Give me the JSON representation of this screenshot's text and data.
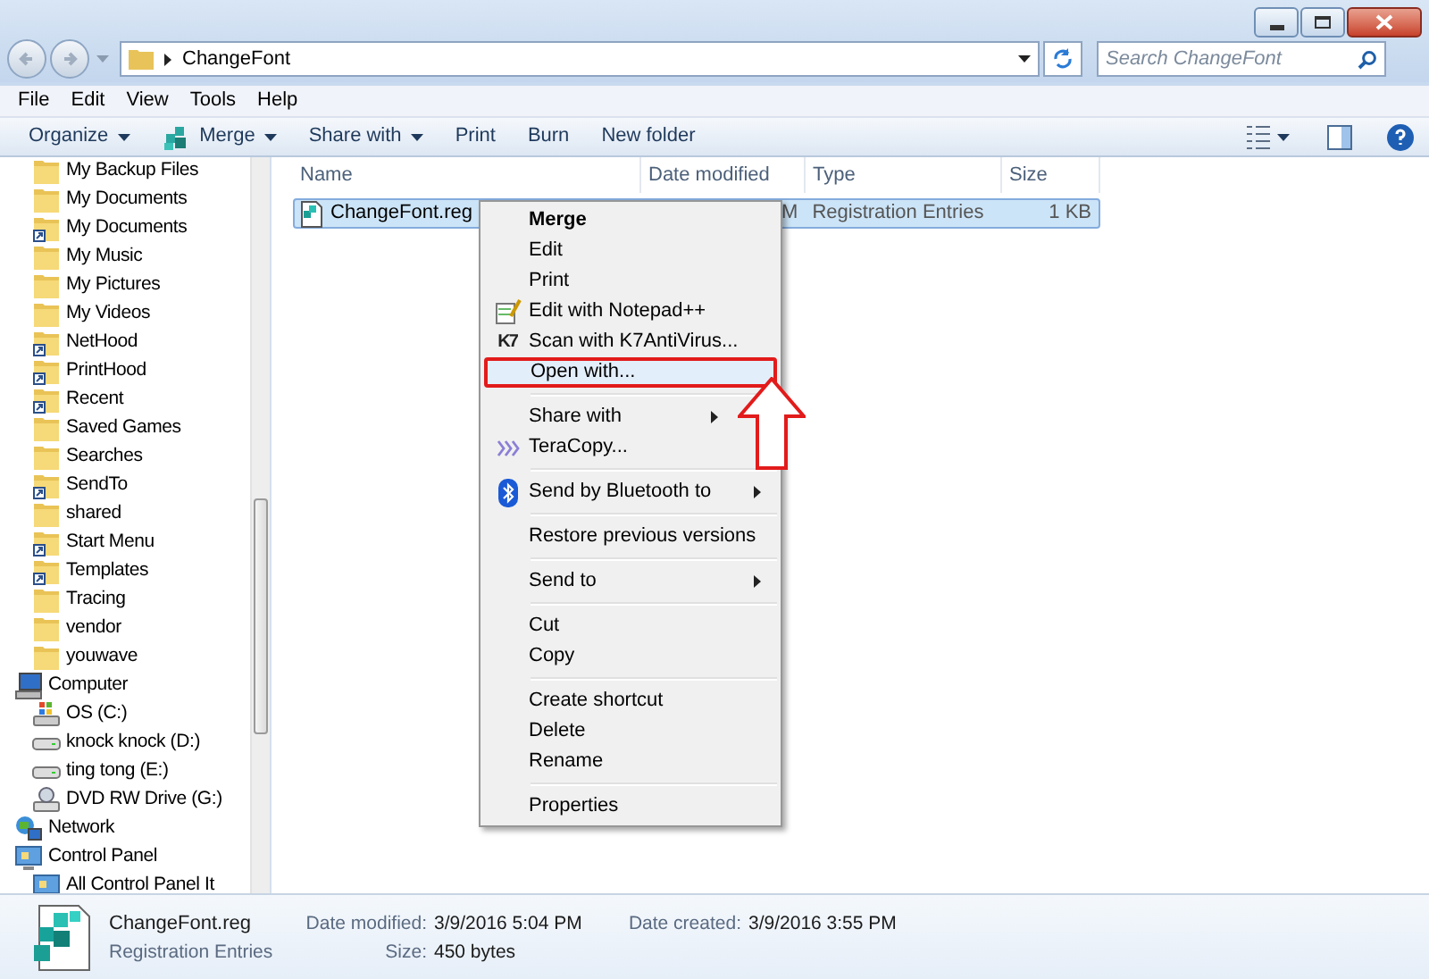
{
  "address": {
    "path": "ChangeFont",
    "search_placeholder": "Search ChangeFont"
  },
  "menu_bar": [
    "File",
    "Edit",
    "View",
    "Tools",
    "Help"
  ],
  "toolbar": [
    {
      "label": "Organize",
      "dropdown": true
    },
    {
      "label": "Merge",
      "dropdown": true
    },
    {
      "label": "Share with",
      "dropdown": true
    },
    {
      "label": "Print",
      "dropdown": false
    },
    {
      "label": "Burn",
      "dropdown": false
    },
    {
      "label": "New folder",
      "dropdown": false
    }
  ],
  "sidebar": {
    "items": [
      {
        "children": [
          {
            "label": "My Backup Files",
            "kind": "folder"
          },
          {
            "label": "My Documents",
            "kind": "folder"
          },
          {
            "label": "My Documents",
            "kind": "shortcut"
          },
          {
            "label": "My Music",
            "kind": "folder"
          },
          {
            "label": "My Pictures",
            "kind": "folder"
          },
          {
            "label": "My Videos",
            "kind": "folder"
          },
          {
            "label": "NetHood",
            "kind": "shortcut"
          },
          {
            "label": "PrintHood",
            "kind": "shortcut"
          },
          {
            "label": "Recent",
            "kind": "shortcut"
          },
          {
            "label": "Saved Games",
            "kind": "folder"
          },
          {
            "label": "Searches",
            "kind": "folder"
          },
          {
            "label": "SendTo",
            "kind": "shortcut"
          },
          {
            "label": "shared",
            "kind": "folder"
          },
          {
            "label": "Start Menu",
            "kind": "shortcut"
          },
          {
            "label": "Templates",
            "kind": "shortcut"
          },
          {
            "label": "Tracing",
            "kind": "folder"
          },
          {
            "label": "vendor",
            "kind": "folder"
          },
          {
            "label": "youwave",
            "kind": "folder"
          }
        ]
      },
      {
        "label": "Computer",
        "kind": "computer",
        "children": [
          {
            "label": "OS (C:)",
            "kind": "system"
          },
          {
            "label": "knock knock (D:)",
            "kind": "drive"
          },
          {
            "label": "ting tong (E:)",
            "kind": "drive"
          },
          {
            "label": "DVD RW Drive (G:)",
            "kind": "dvd"
          }
        ]
      },
      {
        "label": "Network",
        "kind": "network"
      },
      {
        "label": "Control Panel",
        "kind": "panel",
        "children": [
          {
            "label": "All Control Panel It",
            "kind": "panel"
          }
        ]
      }
    ]
  },
  "table": {
    "columns": [
      "Name",
      "Date modified",
      "Type",
      "Size"
    ],
    "rows": [
      {
        "name": "ChangeFont.reg",
        "date_modified": "M",
        "type": "Registration Entries",
        "size": "1 KB",
        "selected": true
      }
    ]
  },
  "context_menu": {
    "items": [
      {
        "kind": "plain",
        "label": "Merge",
        "default": true,
        "submenu": false,
        "selected": false,
        "highlighted": false
      },
      {
        "kind": "plain",
        "label": "Edit",
        "default": false,
        "submenu": false,
        "selected": false,
        "highlighted": false
      },
      {
        "kind": "plain",
        "label": "Print",
        "default": false,
        "submenu": false,
        "selected": false,
        "highlighted": false
      },
      {
        "kind": "notepad",
        "label": "Edit with Notepad++",
        "default": false,
        "submenu": false,
        "selected": false,
        "highlighted": false
      },
      {
        "kind": "antivirus",
        "label": "Scan with K7AntiVirus...",
        "badge": "K7",
        "default": false,
        "submenu": false,
        "selected": false,
        "highlighted": false
      },
      {
        "kind": "plain",
        "label": "Open with...",
        "default": false,
        "submenu": false,
        "selected": true,
        "highlighted": true
      },
      {
        "kind": "separator"
      },
      {
        "kind": "plain",
        "label": "Share with",
        "default": false,
        "submenu": true,
        "selected": false,
        "highlighted": false
      },
      {
        "kind": "teracopy",
        "label": "TeraCopy...",
        "default": false,
        "submenu": false,
        "selected": false,
        "highlighted": false
      },
      {
        "kind": "separator"
      },
      {
        "kind": "bluetooth",
        "label": "Send by Bluetooth to",
        "default": false,
        "submenu": true,
        "selected": false,
        "highlighted": false
      },
      {
        "kind": "separator"
      },
      {
        "kind": "plain",
        "label": "Restore previous versions",
        "default": false,
        "submenu": false,
        "selected": false,
        "highlighted": false
      },
      {
        "kind": "separator"
      },
      {
        "kind": "plain",
        "label": "Send to",
        "default": false,
        "submenu": true,
        "selected": false,
        "highlighted": false
      },
      {
        "kind": "separator"
      },
      {
        "kind": "plain",
        "label": "Cut",
        "default": false,
        "submenu": false,
        "selected": false,
        "highlighted": false
      },
      {
        "kind": "plain",
        "label": "Copy",
        "default": false,
        "submenu": false,
        "selected": false,
        "highlighted": false
      },
      {
        "kind": "separator"
      },
      {
        "kind": "plain",
        "label": "Create shortcut",
        "default": false,
        "submenu": false,
        "selected": false,
        "highlighted": false
      },
      {
        "kind": "plain",
        "label": "Delete",
        "default": false,
        "submenu": false,
        "selected": false,
        "highlighted": false
      },
      {
        "kind": "plain",
        "label": "Rename",
        "default": false,
        "submenu": false,
        "selected": false,
        "highlighted": false
      },
      {
        "kind": "separator"
      },
      {
        "kind": "plain",
        "label": "Properties",
        "default": false,
        "submenu": false,
        "selected": false,
        "highlighted": false
      }
    ]
  },
  "details_pane": {
    "name": "ChangeFont.reg",
    "type": "Registration Entries",
    "fields": [
      {
        "label": "Date modified:",
        "value": "3/9/2016 5:04 PM"
      },
      {
        "label": "Size:",
        "value": "450 bytes"
      },
      {
        "label": "Date created:",
        "value": "3/9/2016 3:55 PM"
      }
    ]
  }
}
